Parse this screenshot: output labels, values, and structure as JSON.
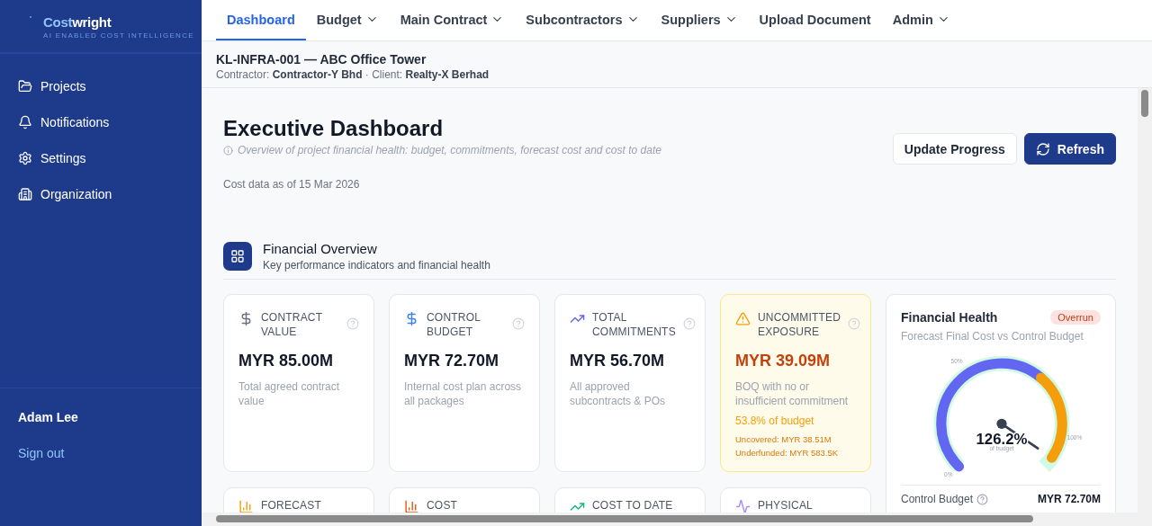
{
  "sidebar": {
    "brand": {
      "part_1": "Cost",
      "part_2": "wright",
      "tagline": "AI ENABLED COST INTELLIGENCE"
    },
    "items": [
      {
        "label": "Projects"
      },
      {
        "label": "Notifications"
      },
      {
        "label": "Settings"
      },
      {
        "label": "Organization"
      }
    ],
    "user": "Adam Lee",
    "sign_out": "Sign out"
  },
  "nav": [
    {
      "label": "Dashboard",
      "selected": true,
      "menu": false
    },
    {
      "label": "Budget",
      "selected": false,
      "menu": true
    },
    {
      "label": "Main Contract",
      "selected": false,
      "menu": true
    },
    {
      "label": "Subcontractors",
      "selected": false,
      "menu": true
    },
    {
      "label": "Suppliers",
      "selected": false,
      "menu": true
    },
    {
      "label": "Upload Document",
      "selected": false,
      "menu": false
    },
    {
      "label": "Admin",
      "selected": false,
      "menu": true
    }
  ],
  "project": {
    "title": "KL-INFRA-001 — ABC Office Tower",
    "details": "Contractor: **Contractor-Y Bhd** · Client: **Realty-X Berhad**"
  },
  "page": {
    "title": "Executive Dashboard",
    "subtitle": "Overview of project financial health: budget, commitments, forecast cost and cost to date",
    "as_of": "Cost data as of 15 Mar 2026",
    "buttons": [
      {
        "label": "Update Progress",
        "kind": "secondary"
      },
      {
        "label": "Refresh",
        "kind": "primary"
      }
    ]
  },
  "section": {
    "title": "Financial Overview",
    "subtitle": "Key performance indicators and financial health"
  },
  "cards": [
    {
      "kind": "stat",
      "title": "CONTRACT VALUE",
      "value": "MYR 85.00M",
      "description": "Total agreed contract value"
    },
    {
      "kind": "stat",
      "title": "CONTROL BUDGET",
      "value": "MYR 72.70M",
      "description": "Internal cost plan across all packages"
    },
    {
      "kind": "stat",
      "title": "TOTAL COMMITMENTS",
      "value": "MYR 56.70M",
      "description": "All approved subcontracts & POs"
    },
    {
      "kind": "alert",
      "title": "UNCOMMITTED EXPOSURE",
      "value": "MYR 39.09M",
      "description": "BOQ with no or insufficient commitment",
      "share": "53.8% of budget",
      "notes": [
        "Uncovered: MYR 38.51M",
        "Underfunded: MYR 583.5K"
      ]
    },
    {
      "kind": "gauge",
      "title": "Financial Health",
      "badge": "Overrun",
      "subtitle": "Forecast Final Cost vs Control Budget",
      "reading": "126.2%",
      "reading_caption": "of budget",
      "ticks": [
        "0%",
        "50%",
        "100%"
      ],
      "row_label": "Control Budget",
      "row_value": "MYR 72.70M"
    }
  ],
  "cards_row_2": [
    {
      "title": "FORECAST"
    },
    {
      "title": "COST"
    },
    {
      "title": "COST TO DATE"
    },
    {
      "title": "PHYSICAL"
    }
  ]
}
